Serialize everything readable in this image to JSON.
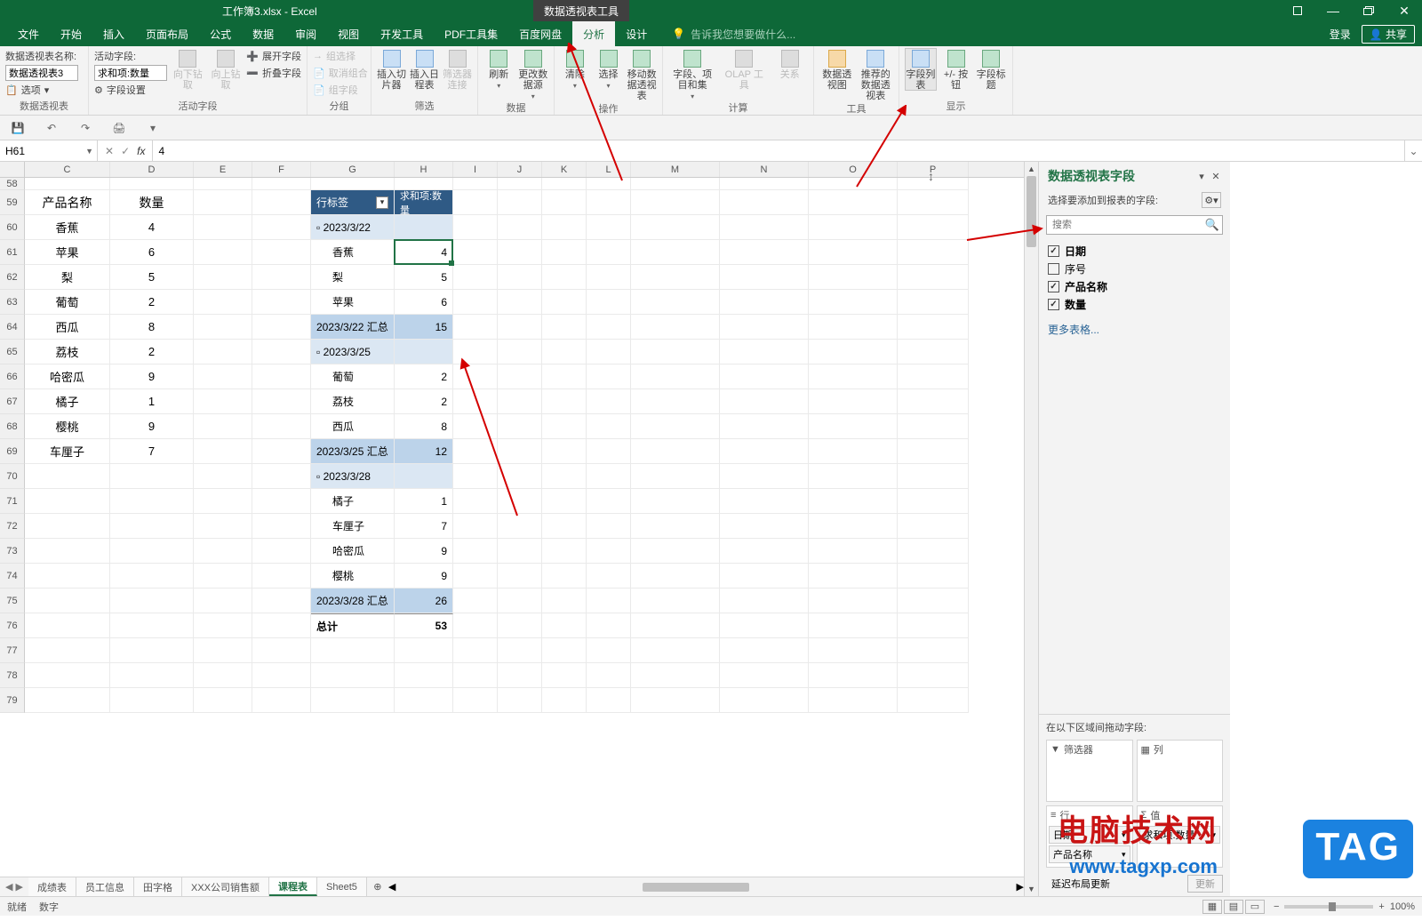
{
  "title": "工作簿3.xlsx - Excel",
  "tool_tab": "数据透视表工具",
  "ribbon_tabs": [
    "文件",
    "开始",
    "插入",
    "页面布局",
    "公式",
    "数据",
    "审阅",
    "视图",
    "开发工具",
    "PDF工具集",
    "百度网盘",
    "分析",
    "设计"
  ],
  "active_tab_index": 11,
  "tell_me": "告诉我您想要做什么...",
  "login": "登录",
  "share": "共享",
  "ribbon": {
    "g1_title": "数据透视表",
    "g1_name_label": "数据透视表名称:",
    "g1_name_value": "数据透视表3",
    "g1_options": "选项",
    "g2_title": "活动字段",
    "g2_af_label": "活动字段:",
    "g2_af_value": "求和项:数量",
    "g2_fs": "字段设置",
    "g2_drilldown": "向下钻取",
    "g2_drillup": "向上钻取",
    "g2_expand": "展开字段",
    "g2_collapse": "折叠字段",
    "g3_title": "分组",
    "g3_sel": "组选择",
    "g3_ungroup": "取消组合",
    "g3_field": "组字段",
    "g4_title": "筛选",
    "g4_slicer": "插入切片器",
    "g4_timeline": "插入日程表",
    "g4_conn": "筛选器连接",
    "g5_title": "数据",
    "g5_refresh": "刷新",
    "g5_change": "更改数据源",
    "g6_title": "操作",
    "g6_clear": "清除",
    "g6_select": "选择",
    "g6_move": "移动数据透视表",
    "g7_title": "计算",
    "g7_fields": "字段、项目和集",
    "g7_olap": "OLAP 工具",
    "g7_rel": "关系",
    "g8_title": "工具",
    "g8_chart": "数据透视图",
    "g8_rec": "推荐的数据透视表",
    "g9_title": "显示",
    "g9_fl": "字段列表",
    "g9_pm": "+/- 按钮",
    "g9_fh": "字段标题"
  },
  "namebox": "H61",
  "formula": "4",
  "columns": [
    "C",
    "D",
    "E",
    "F",
    "G",
    "H",
    "I",
    "J",
    "K",
    "L",
    "M",
    "N",
    "O",
    "P"
  ],
  "row_start": 58,
  "data_table": {
    "h1": "产品名称",
    "h2": "数量",
    "rows": [
      {
        "n": "香蕉",
        "q": "4"
      },
      {
        "n": "苹果",
        "q": "6"
      },
      {
        "n": "梨",
        "q": "5"
      },
      {
        "n": "葡萄",
        "q": "2"
      },
      {
        "n": "西瓜",
        "q": "8"
      },
      {
        "n": "荔枝",
        "q": "2"
      },
      {
        "n": "哈密瓜",
        "q": "9"
      },
      {
        "n": "橘子",
        "q": "1"
      },
      {
        "n": "樱桃",
        "q": "9"
      },
      {
        "n": "车厘子",
        "q": "7"
      }
    ]
  },
  "pivot": {
    "row_label": "行标签",
    "value_label": "求和项:数量",
    "groups": [
      {
        "date": "2023/3/22",
        "items": [
          {
            "n": "香蕉",
            "v": "4"
          },
          {
            "n": "梨",
            "v": "5"
          },
          {
            "n": "苹果",
            "v": "6"
          }
        ],
        "subtotal_label": "2023/3/22 汇总",
        "subtotal": "15"
      },
      {
        "date": "2023/3/25",
        "items": [
          {
            "n": "葡萄",
            "v": "2"
          },
          {
            "n": "荔枝",
            "v": "2"
          },
          {
            "n": "西瓜",
            "v": "8"
          }
        ],
        "subtotal_label": "2023/3/25 汇总",
        "subtotal": "12"
      },
      {
        "date": "2023/3/28",
        "items": [
          {
            "n": "橘子",
            "v": "1"
          },
          {
            "n": "车厘子",
            "v": "7"
          },
          {
            "n": "哈密瓜",
            "v": "9"
          },
          {
            "n": "樱桃",
            "v": "9"
          }
        ],
        "subtotal_label": "2023/3/28 汇总",
        "subtotal": "26"
      }
    ],
    "grand_label": "总计",
    "grand": "53"
  },
  "pane": {
    "title": "数据透视表字段",
    "subtitle": "选择要添加到报表的字段:",
    "search_placeholder": "搜索",
    "fields": [
      {
        "label": "日期",
        "checked": true
      },
      {
        "label": "序号",
        "checked": false
      },
      {
        "label": "产品名称",
        "checked": true
      },
      {
        "label": "数量",
        "checked": true
      }
    ],
    "more": "更多表格...",
    "areas_label": "在以下区域间拖动字段:",
    "filter_label": "筛选器",
    "col_label": "列",
    "row_label": "行",
    "val_label": "值",
    "rows": [
      "日期",
      "产品名称"
    ],
    "vals": [
      "求和项:数量"
    ],
    "defer": "延迟布局更新",
    "update": "更新"
  },
  "sheet_tabs": [
    "成绩表",
    "员工信息",
    "田字格",
    "XXX公司销售额",
    "课程表",
    "Sheet5"
  ],
  "active_sheet": 4,
  "status": {
    "ready": "就绪",
    "mode": "数字"
  },
  "zoom": "100%",
  "wm1": "电脑技术网",
  "wm2": "www.tagxp.com",
  "tag": "TAG"
}
